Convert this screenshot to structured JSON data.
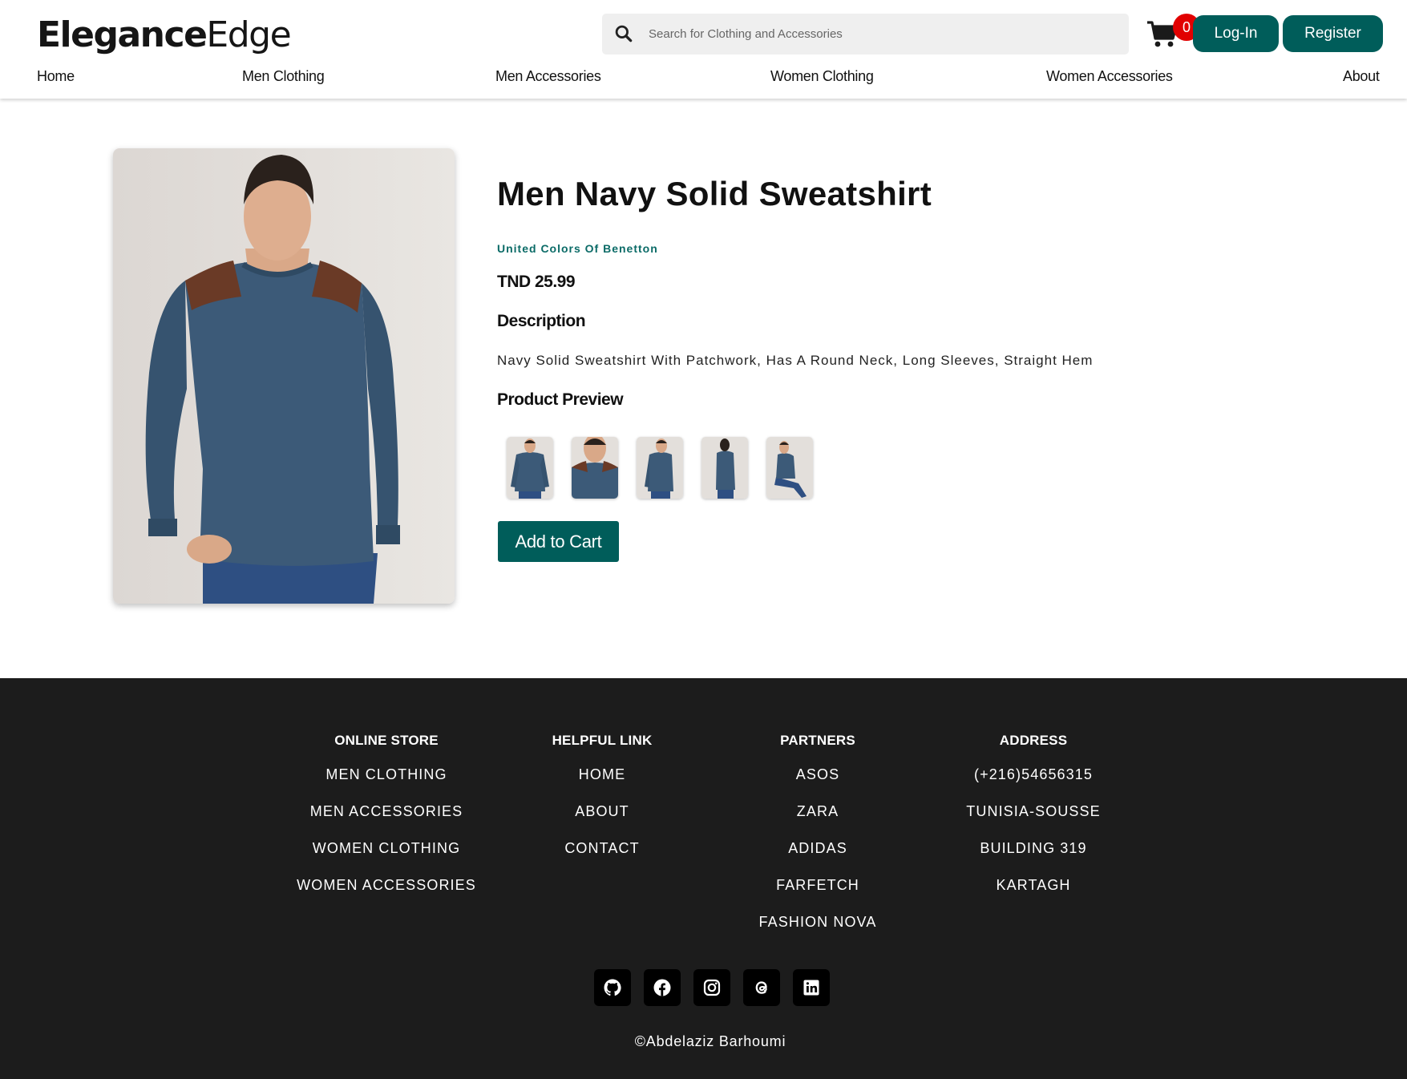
{
  "header": {
    "logo": {
      "bold": "Elegance",
      "light": "Edge"
    },
    "search": {
      "placeholder": "Search for Clothing and Accessories",
      "value": ""
    },
    "cart_count": "0",
    "login_label": "Log-In",
    "register_label": "Register"
  },
  "nav": {
    "items": [
      "Home",
      "Men Clothing",
      "Men Accessories",
      "Women Clothing",
      "Women Accessories",
      "About"
    ]
  },
  "product": {
    "title": "Men Navy Solid Sweatshirt",
    "brand": "United Colors Of Benetton",
    "price": "TND 25.99",
    "description_heading": "Description",
    "description": "Navy Solid Sweatshirt With Patchwork, Has A Round Neck, Long Sleeves, Straight Hem",
    "preview_heading": "Product Preview",
    "preview_count": 5,
    "add_to_cart_label": "Add to Cart"
  },
  "colors": {
    "accent": "#005d5a",
    "brand_text": "#0b6b67",
    "badge": "#e10000",
    "footer_bg": "#1c1c1c",
    "sweatshirt": "#3c5a78",
    "shoulder_patch": "#6a3a26"
  },
  "footer": {
    "columns": [
      {
        "heading": "ONLINE STORE",
        "links": [
          "MEN CLOTHING",
          "MEN ACCESSORIES",
          "WOMEN CLOTHING",
          "WOMEN ACCESSORIES"
        ]
      },
      {
        "heading": "HELPFUL LINK",
        "links": [
          "HOME",
          "ABOUT",
          "CONTACT"
        ]
      },
      {
        "heading": "PARTNERS",
        "links": [
          "ASOS",
          "ZARA",
          "ADIDAS",
          "FARFETCH",
          "FASHION NOVA"
        ]
      },
      {
        "heading": "ADDRESS",
        "lines": [
          "(+216)54656315",
          "TUNISIA-SOUSSE",
          "BUILDING 319",
          "KARTAGH"
        ]
      }
    ],
    "socials": [
      "github-icon",
      "facebook-icon",
      "instagram-icon",
      "threads-icon",
      "linkedin-icon"
    ],
    "copyright": "©Abdelaziz Barhoumi"
  }
}
